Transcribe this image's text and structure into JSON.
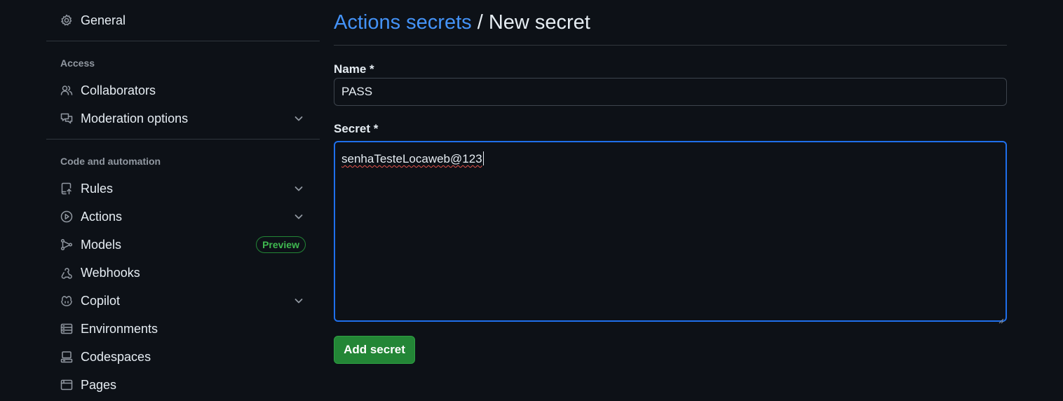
{
  "sidebar": {
    "general_label": "General",
    "access_heading": "Access",
    "access_items": [
      {
        "label": "Collaborators",
        "icon": "people-icon"
      },
      {
        "label": "Moderation options",
        "icon": "comment-discussion-icon"
      }
    ],
    "code_heading": "Code and automation",
    "code_items": [
      {
        "label": "Rules",
        "icon": "repo-push-icon"
      },
      {
        "label": "Actions",
        "icon": "play-icon"
      },
      {
        "label": "Models",
        "icon": "git-branch-icon",
        "badge": "Preview"
      },
      {
        "label": "Webhooks",
        "icon": "webhook-icon"
      },
      {
        "label": "Copilot",
        "icon": "copilot-icon"
      },
      {
        "label": "Environments",
        "icon": "server-icon"
      },
      {
        "label": "Codespaces",
        "icon": "codespaces-icon"
      },
      {
        "label": "Pages",
        "icon": "browser-icon"
      }
    ]
  },
  "main": {
    "breadcrumb_link": "Actions secrets",
    "breadcrumb_separator": " / ",
    "breadcrumb_current": "New secret",
    "name_label": "Name *",
    "name_value": "PASS",
    "secret_label": "Secret *",
    "secret_value": "senhaTesteLocaweb@123",
    "submit_label": "Add secret"
  },
  "colors": {
    "background": "#0d1117",
    "link": "#4493f8",
    "button": "#238636",
    "badge": "#3fb950",
    "focus_border": "#1f6feb"
  }
}
